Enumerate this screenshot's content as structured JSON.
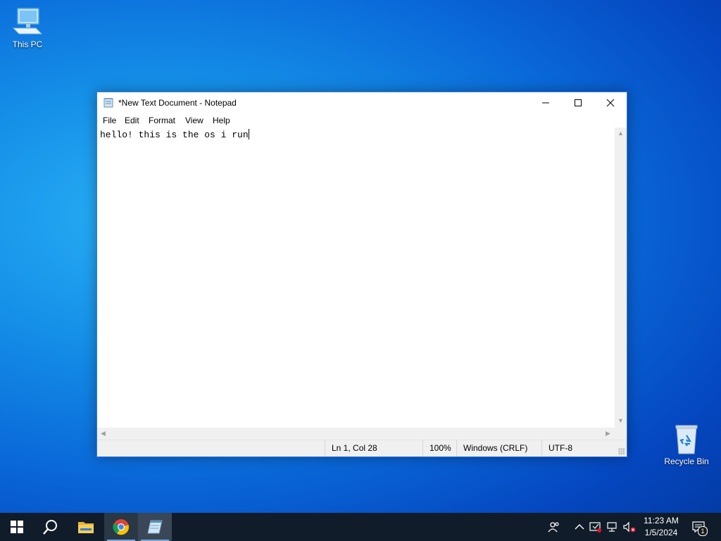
{
  "desktop": {
    "icons": [
      {
        "label": "This PC",
        "icon": "computer-icon"
      },
      {
        "label": "Recycle Bin",
        "icon": "recycle-bin-icon"
      }
    ]
  },
  "notepad": {
    "title": "*New Text Document - Notepad",
    "menu": [
      "File",
      "Edit",
      "Format",
      "View",
      "Help"
    ],
    "content": "hello! this is the os i run",
    "status": {
      "position": "Ln 1, Col 28",
      "zoom": "100%",
      "line_endings": "Windows (CRLF)",
      "encoding": "UTF-8"
    }
  },
  "taskbar": {
    "items": [
      "start-icon",
      "search-icon",
      "file-explorer-icon",
      "chrome-icon",
      "notepad-icon"
    ],
    "clock": {
      "time": "11:23 AM",
      "date": "1/5/2024"
    },
    "notification_count": "1",
    "tray": [
      "people-icon",
      "chevron-up-icon",
      "security-icon",
      "network-icon",
      "volume-muted-icon",
      "action-center-icon"
    ]
  },
  "colors": {
    "desktop": "#0a6ad9",
    "taskbar": "#101c2a",
    "accent": "#3a7bd5"
  }
}
